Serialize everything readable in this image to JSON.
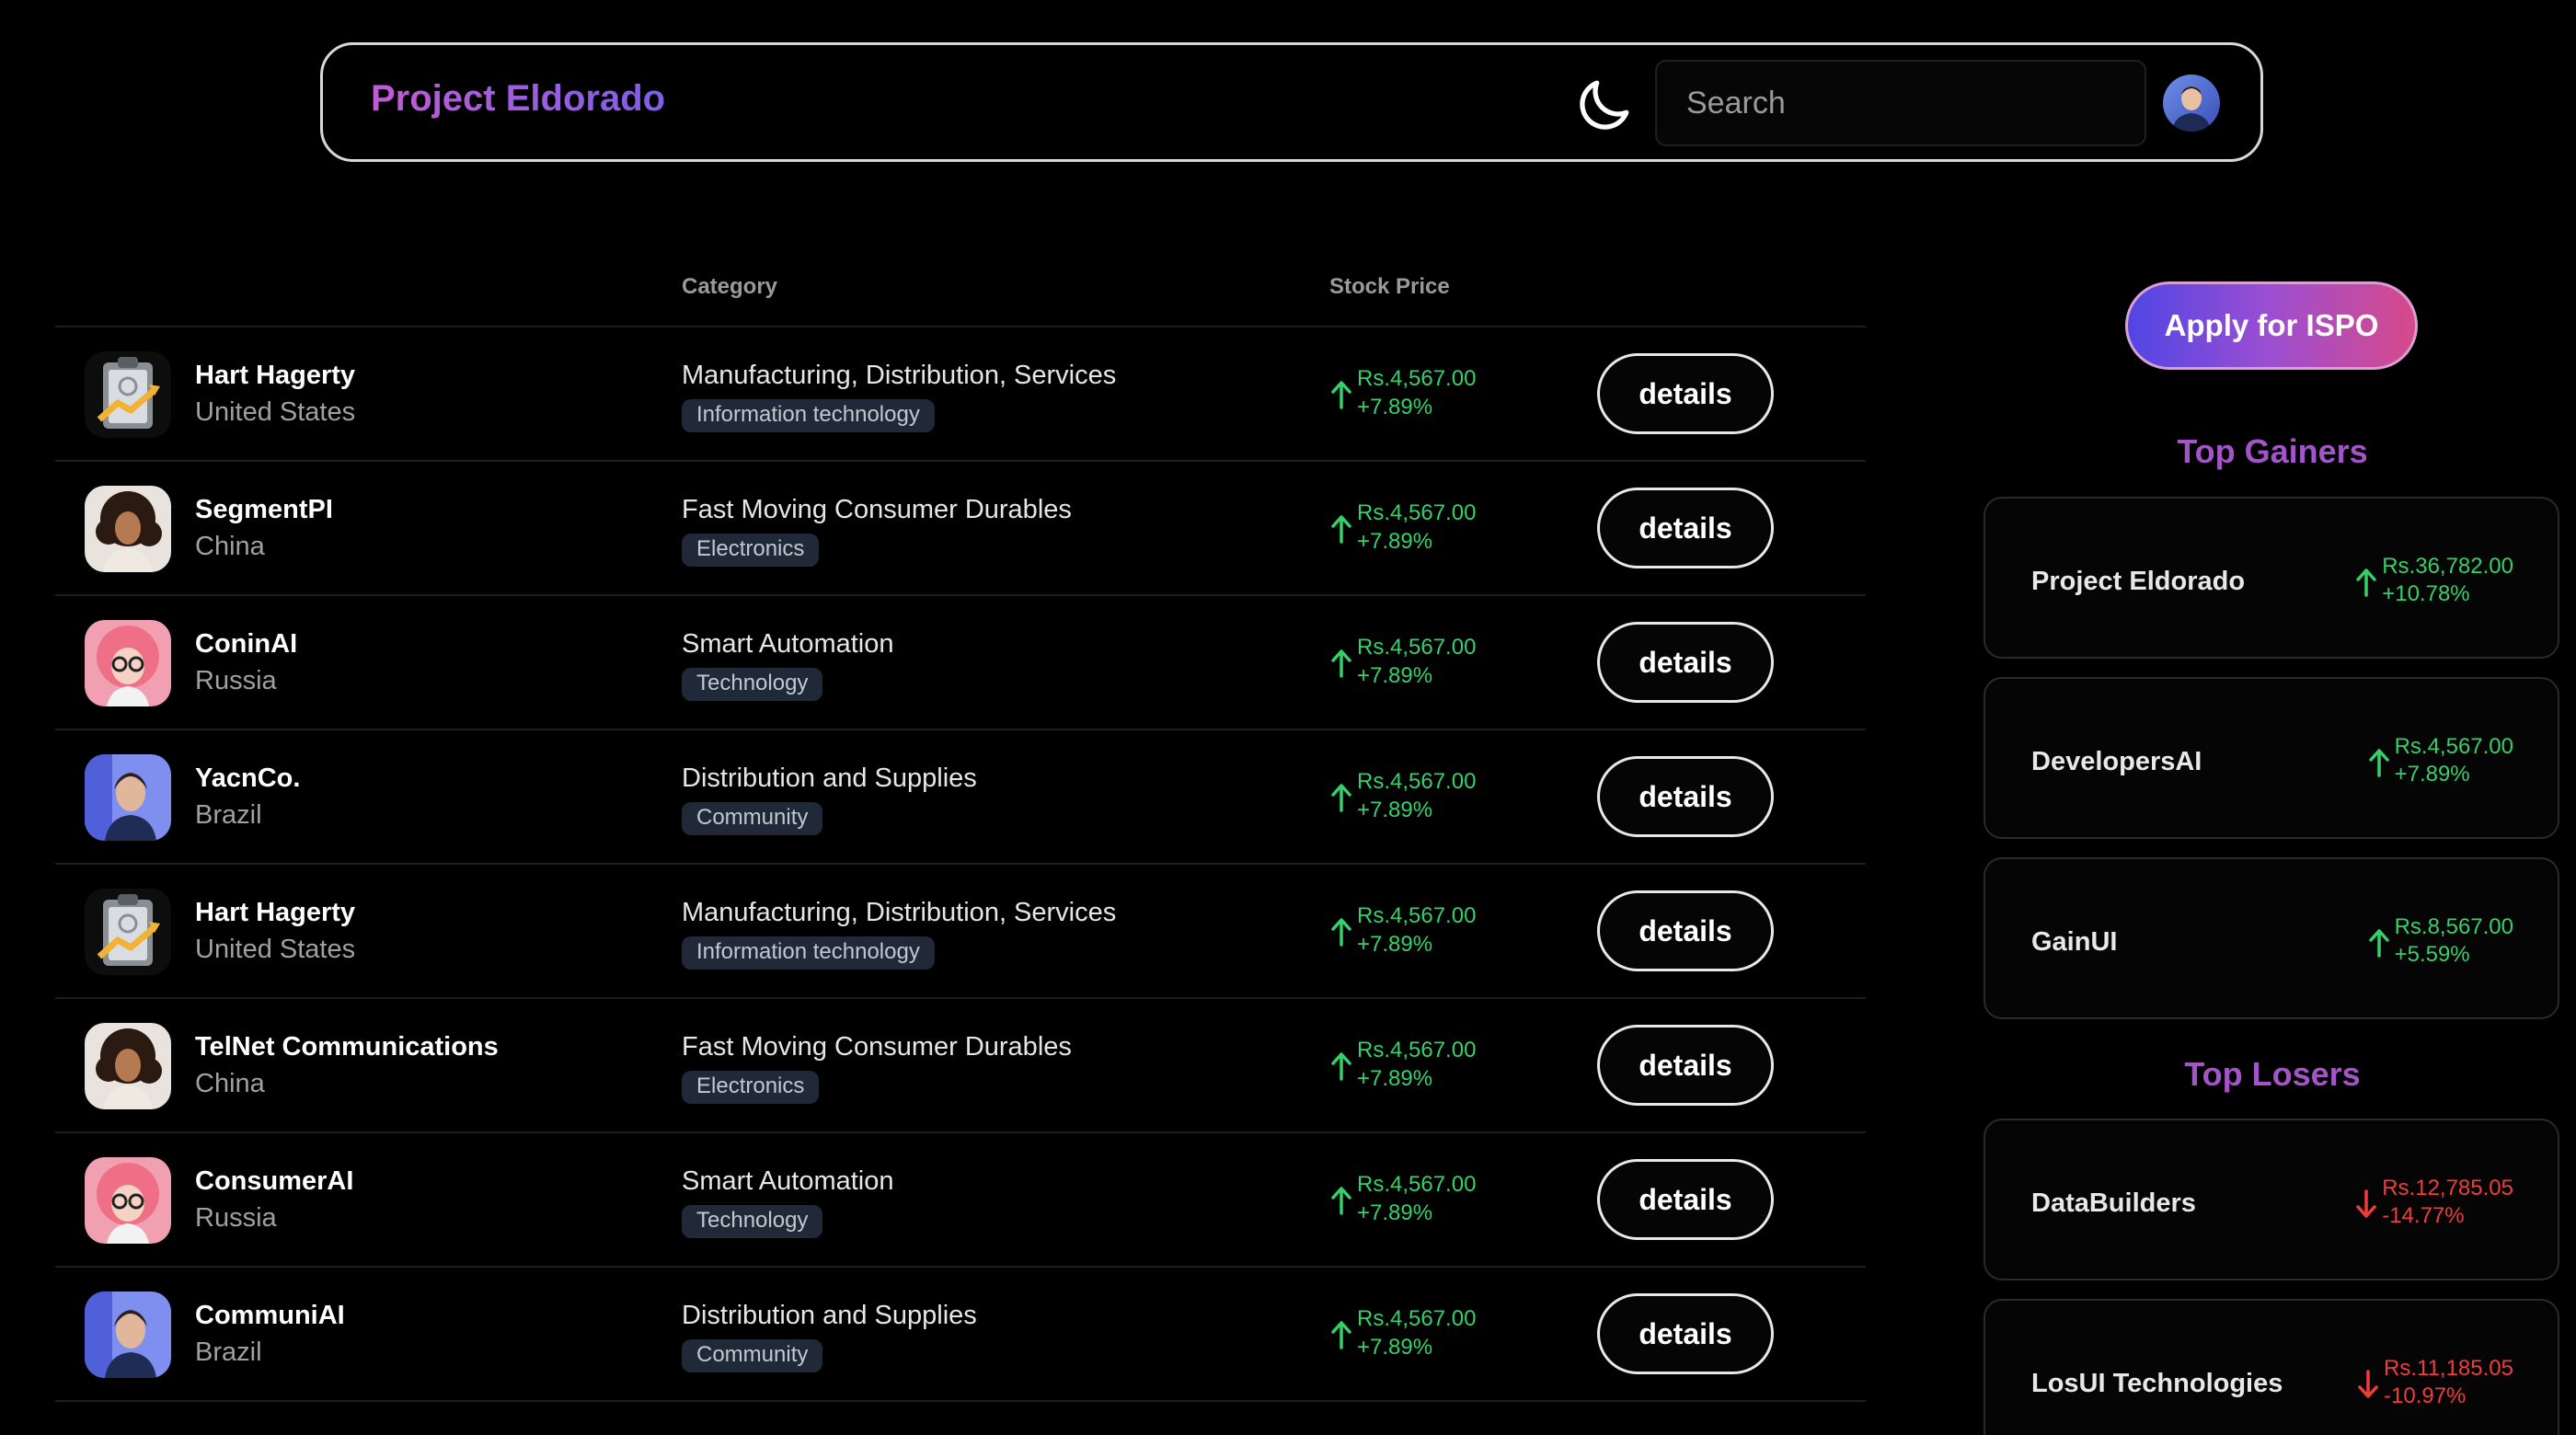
{
  "header": {
    "brand": "Project Eldorado",
    "search_placeholder": "Search",
    "theme_icon": "moon-icon",
    "user_avatar": "user-avatar"
  },
  "table": {
    "headers": {
      "name": "",
      "category": "Category",
      "price": "Stock Price",
      "action": ""
    },
    "rows": [
      {
        "name": "Hart Hagerty",
        "country": "United States",
        "category": "Manufacturing, Distribution, Services",
        "tag": "Information technology",
        "price": "Rs.4,567.00",
        "change": "+7.89%",
        "action": "details",
        "avatar": "clipboard-chart-icon"
      },
      {
        "name": "SegmentPI",
        "country": "China",
        "category": "Fast Moving Consumer Durables",
        "tag": "Electronics",
        "price": "Rs.4,567.00",
        "change": "+7.89%",
        "action": "details",
        "avatar": "curly-hair-portrait"
      },
      {
        "name": "ConinAI",
        "country": "Russia",
        "category": "Smart Automation",
        "tag": "Technology",
        "price": "Rs.4,567.00",
        "change": "+7.89%",
        "action": "details",
        "avatar": "pink-hair-portrait"
      },
      {
        "name": "YacnCo.",
        "country": "Brazil",
        "category": "Distribution and Supplies",
        "tag": "Community",
        "price": "Rs.4,567.00",
        "change": "+7.89%",
        "action": "details",
        "avatar": "blue-light-portrait"
      },
      {
        "name": "Hart Hagerty",
        "country": "United States",
        "category": "Manufacturing, Distribution, Services",
        "tag": "Information technology",
        "price": "Rs.4,567.00",
        "change": "+7.89%",
        "action": "details",
        "avatar": "clipboard-chart-icon"
      },
      {
        "name": "TelNet Communications",
        "country": "China",
        "category": "Fast Moving Consumer Durables",
        "tag": "Electronics",
        "price": "Rs.4,567.00",
        "change": "+7.89%",
        "action": "details",
        "avatar": "curly-hair-portrait"
      },
      {
        "name": "ConsumerAI",
        "country": "Russia",
        "category": "Smart Automation",
        "tag": "Technology",
        "price": "Rs.4,567.00",
        "change": "+7.89%",
        "action": "details",
        "avatar": "pink-hair-portrait"
      },
      {
        "name": "CommuniAI",
        "country": "Brazil",
        "category": "Distribution and Supplies",
        "tag": "Community",
        "price": "Rs.4,567.00",
        "change": "+7.89%",
        "action": "details",
        "avatar": "blue-light-portrait"
      }
    ]
  },
  "sidebar": {
    "apply_label": "Apply for ISPO",
    "gainers_title": "Top Gainers",
    "gainers": [
      {
        "name": "Project Eldorado",
        "price": "Rs.36,782.00",
        "change": "+10.78%"
      },
      {
        "name": "DevelopersAI",
        "price": "Rs.4,567.00",
        "change": "+7.89%"
      },
      {
        "name": "GainUI",
        "price": "Rs.8,567.00",
        "change": "+5.59%"
      }
    ],
    "losers_title": "Top Losers",
    "losers": [
      {
        "name": "DataBuilders",
        "price": "Rs.12,785.05",
        "change": "-14.77%"
      },
      {
        "name": "LosUI Technologies",
        "price": "Rs.11,185.05",
        "change": "-10.97%"
      }
    ]
  },
  "colors": {
    "background": "#000000",
    "gain": "#34d16a",
    "loss": "#f23c3c",
    "accent_title": "#a454c9",
    "tag_bg": "#1f2937"
  }
}
